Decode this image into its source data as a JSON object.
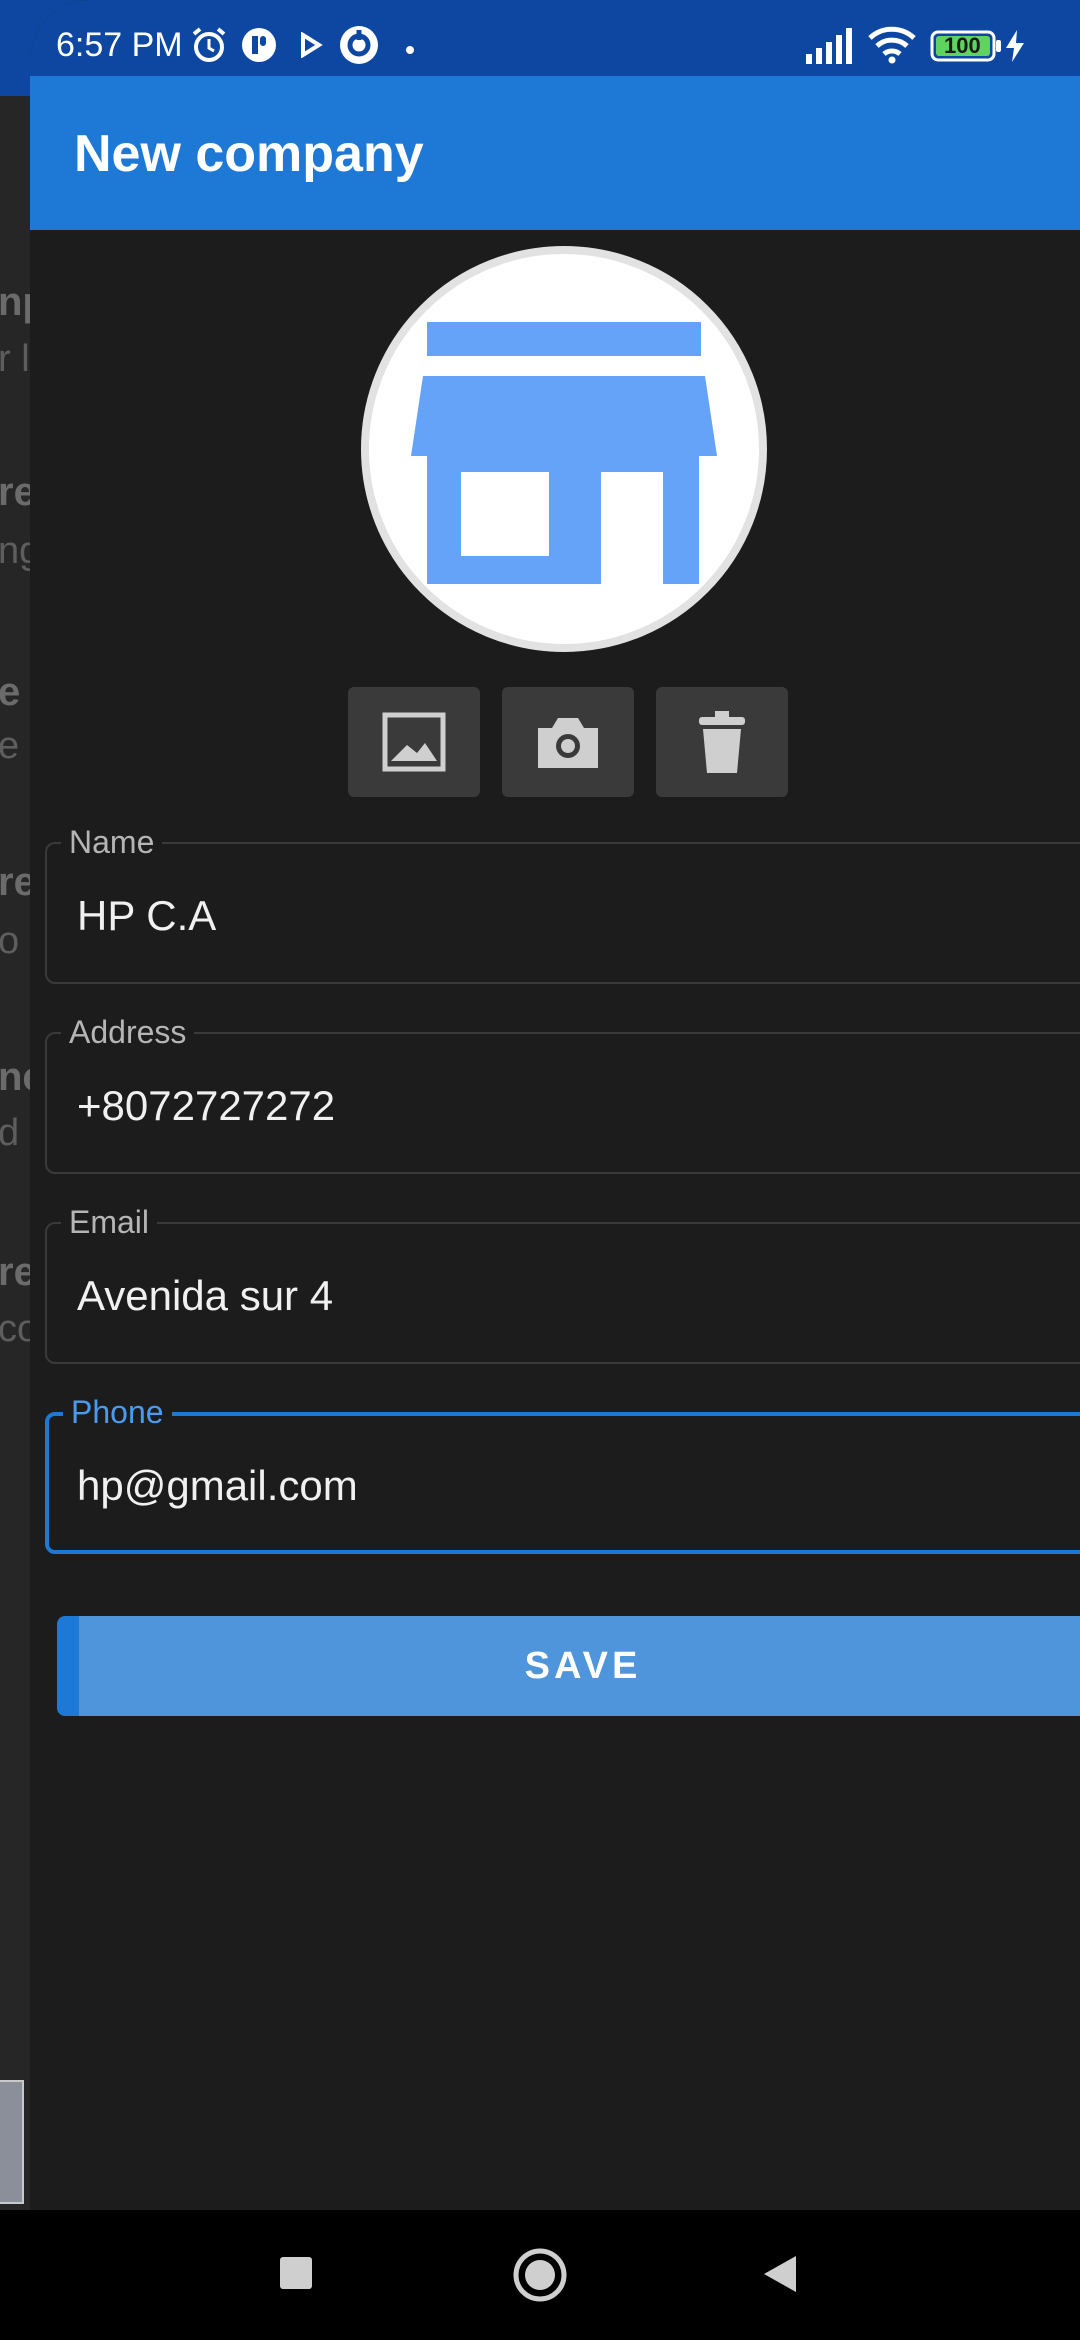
{
  "status_bar": {
    "time": "6:57 PM",
    "battery": "100",
    "icons": [
      "alarm-icon",
      "notification-icon",
      "play-icon",
      "sync-icon",
      "dot-icon",
      "signal-icon",
      "wifi-icon",
      "battery-icon",
      "charging-icon"
    ]
  },
  "background_list": {
    "items": [
      {
        "title": "np",
        "subtitle": "r l"
      },
      {
        "title": "re",
        "subtitle": "ng"
      },
      {
        "title": "e a",
        "subtitle": "e t"
      },
      {
        "title": "re",
        "subtitle": "o r"
      },
      {
        "title": "ne",
        "subtitle": "d"
      },
      {
        "title": "re",
        "subtitle": "co"
      }
    ]
  },
  "app_bar": {
    "title": "New company"
  },
  "avatar": {
    "icon": "store-icon",
    "color": "#64a3f7"
  },
  "actions": [
    {
      "name": "gallery-button",
      "icon": "image-icon"
    },
    {
      "name": "camera-button",
      "icon": "camera-icon"
    },
    {
      "name": "delete-button",
      "icon": "trash-icon"
    }
  ],
  "form": {
    "name": {
      "label": "Name",
      "value": "HP C.A"
    },
    "address": {
      "label": "Address",
      "value": "+8072727272"
    },
    "email": {
      "label": "Email",
      "value": "Avenida sur 4"
    },
    "phone": {
      "label": "Phone",
      "value": "hp@gmail.com"
    }
  },
  "save_button": {
    "label": "SAVE"
  },
  "colors": {
    "accent": "#1e78d6",
    "status_bar": "#0d47a1",
    "sheet_bg": "#1c1c1c"
  },
  "nav_bar": {
    "icons": [
      "recents-icon",
      "home-icon",
      "back-icon"
    ]
  }
}
